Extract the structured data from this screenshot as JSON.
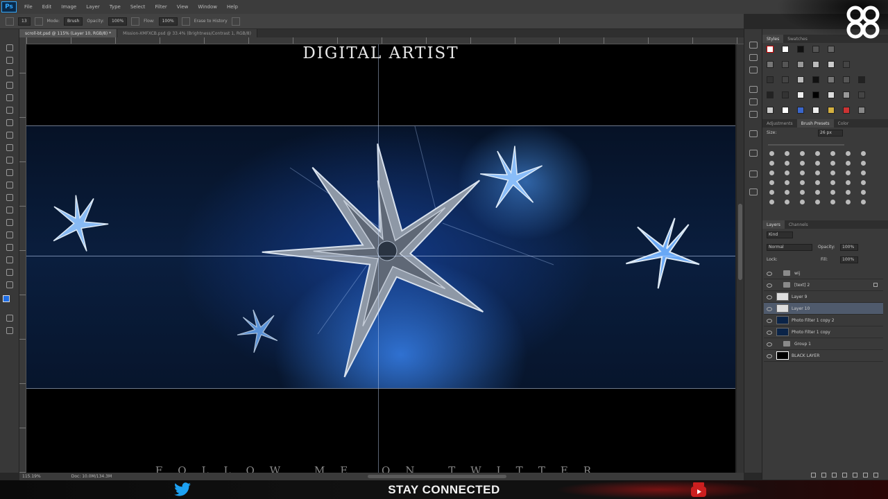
{
  "app": {
    "logo": "Ps",
    "menu": [
      "File",
      "Edit",
      "Image",
      "Layer",
      "Type",
      "Select",
      "Filter",
      "View",
      "Window",
      "Help"
    ]
  },
  "options": {
    "mode_label": "Mode:",
    "mode_value": "Brush",
    "opacity_label": "Opacity:",
    "opacity_value": "100%",
    "flow_label": "Flow:",
    "flow_value": "100%",
    "erase_label": "Erase to History"
  },
  "tabs": [
    {
      "label": "scroll-bt.psd @ 115% (Layer 10, RGB/8) *"
    },
    {
      "label": "Mission-XMFXCB.psd @ 33.4% (Brightness/Contrast 1, RGB/8)"
    }
  ],
  "canvas": {
    "title": "DIGITAL ARTIST",
    "footer": "FOLLOW ME ON TWITTER"
  },
  "status": {
    "zoom": "115.19%",
    "doc": "Doc: 10.0M/134.3M"
  },
  "panels": {
    "top_tabs": [
      "Styles",
      "Swatches"
    ],
    "mid_tabs": [
      "Adjustments",
      "Brush Presets",
      "Color"
    ],
    "size_label": "Size:",
    "size_value": "26 px",
    "layer_tabs": [
      "Layers",
      "Channels"
    ],
    "kind_label": "Kind",
    "blend_mode": "Normal",
    "opacity_label": "Opacity:",
    "opacity_value": "100%",
    "lock_label": "Lock:",
    "fill_label": "Fill:",
    "fill_value": "100%",
    "layers": [
      {
        "name": "wij",
        "type": "folder",
        "selected": false
      },
      {
        "name": "[text] 2",
        "type": "folder",
        "selected": false
      },
      {
        "name": "Layer 9",
        "type": "white",
        "selected": false
      },
      {
        "name": "Layer 10",
        "type": "white",
        "selected": true
      },
      {
        "name": "Photo Filter 1 copy 2",
        "type": "blue",
        "selected": false
      },
      {
        "name": "Photo Filter 1 copy",
        "type": "blue",
        "selected": false
      },
      {
        "name": "Group 1",
        "type": "folder",
        "selected": false
      },
      {
        "name": "BLACK LAYER",
        "type": "black",
        "selected": false
      }
    ]
  },
  "overlay": {
    "stay_connected": "STAY CONNECTED"
  },
  "colors": {
    "accent": "#31a8ff",
    "twitter": "#1da1f2",
    "youtube": "#cc1f1f"
  }
}
